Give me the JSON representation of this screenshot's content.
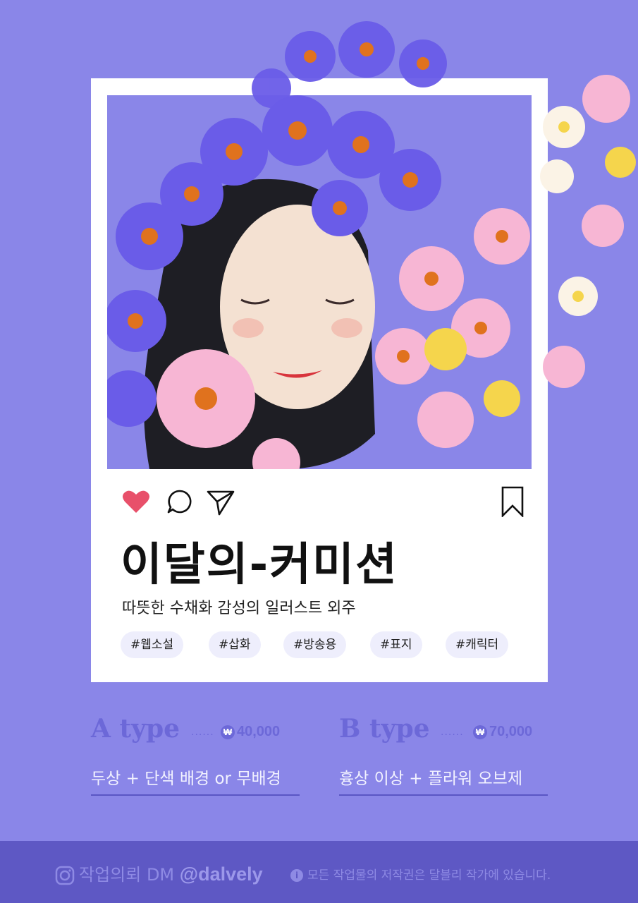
{
  "card": {
    "title": "이달의-커미션",
    "subtitle": "따뜻한 수채화 감성의 일러스트 외주",
    "tags": [
      "#웹소설",
      "#삽화",
      "#방송용",
      "#표지",
      "#캐릭터"
    ],
    "icons": [
      "heart-icon",
      "comment-icon",
      "send-icon",
      "bookmark-icon"
    ]
  },
  "types": [
    {
      "name": "A type",
      "dots": "······",
      "currency_symbol": "₩",
      "price": "40,000",
      "desc": "두상 + 단색 배경 or 무배경"
    },
    {
      "name": "B type",
      "dots": "······",
      "currency_symbol": "₩",
      "price": "70,000",
      "desc": "흉상 이상 + 플라워 오브제"
    }
  ],
  "footer": {
    "contact_label": "작업의뢰 DM",
    "handle": "@dalvely",
    "info_glyph": "i",
    "notice": "모든 작업물의 저작권은 달블리 작가에 있습니다."
  },
  "colors": {
    "background": "#8a86e8",
    "accent": "#6c68d8",
    "footer": "#5e58c4",
    "heart": "#e8506a"
  }
}
